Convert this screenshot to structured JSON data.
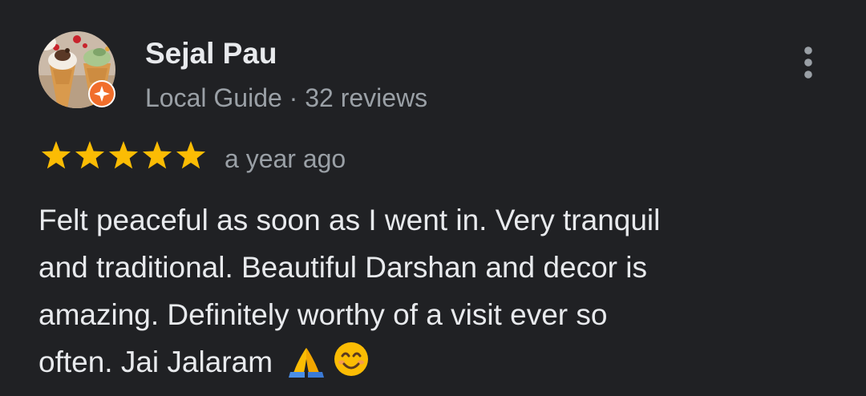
{
  "review": {
    "author": {
      "name": "Sejal Pau",
      "meta": "Local Guide · 32 reviews",
      "avatar": "profile-photo-ice-cream-cones",
      "badge_icon": "local-guide-star-icon"
    },
    "rating": 5,
    "rating_max": 5,
    "time": "a year ago",
    "text_lines": [
      "Felt peaceful as soon as I went in. Very tranquil",
      "and traditional. Beautiful Darshan and decor is",
      "amazing. Definitely worthy of a visit ever so",
      "often. Jai Jalaram "
    ],
    "text_emojis": [
      "folded-hands-emoji",
      "smiling-face-emoji"
    ],
    "menu_icon": "more-vert-icon"
  },
  "colors": {
    "background": "#202124",
    "primary_text": "#e8eaed",
    "secondary_text": "#9aa0a6",
    "star": "#fbbc04",
    "guide_badge": "#f16e2b"
  }
}
